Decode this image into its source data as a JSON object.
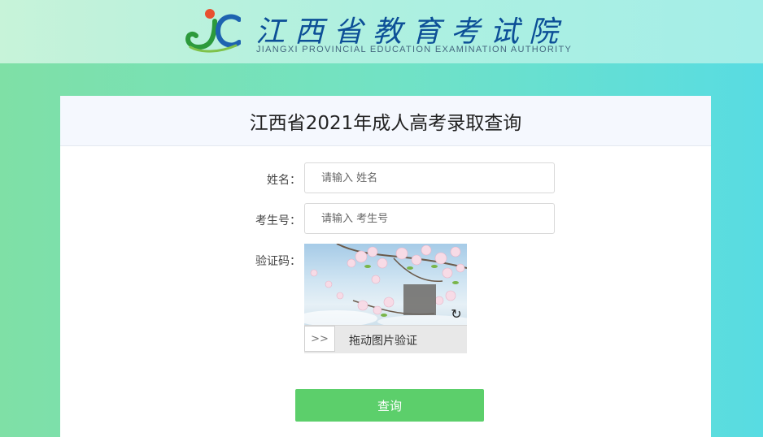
{
  "header": {
    "logo_cn": "江西省教育考试院",
    "logo_en": "JIANGXI PROVINCIAL EDUCATION EXAMINATION AUTHORITY"
  },
  "panel": {
    "title": "江西省2021年成人高考录取查询"
  },
  "form": {
    "name": {
      "label": "姓名：",
      "placeholder": "请输入 姓名",
      "value": ""
    },
    "exam_number": {
      "label": "考生号：",
      "placeholder": "请输入 考生号",
      "value": ""
    },
    "captcha": {
      "label": "验证码：",
      "slider_handle": ">>",
      "slider_text": "拖动图片验证",
      "refresh_icon": "refresh-icon"
    },
    "submit_label": "查询"
  },
  "colors": {
    "background_left": "#7fe0a6",
    "background_right": "#58dce2",
    "logo_blue": "#0c4f97",
    "submit_green": "#5ccf6b"
  }
}
